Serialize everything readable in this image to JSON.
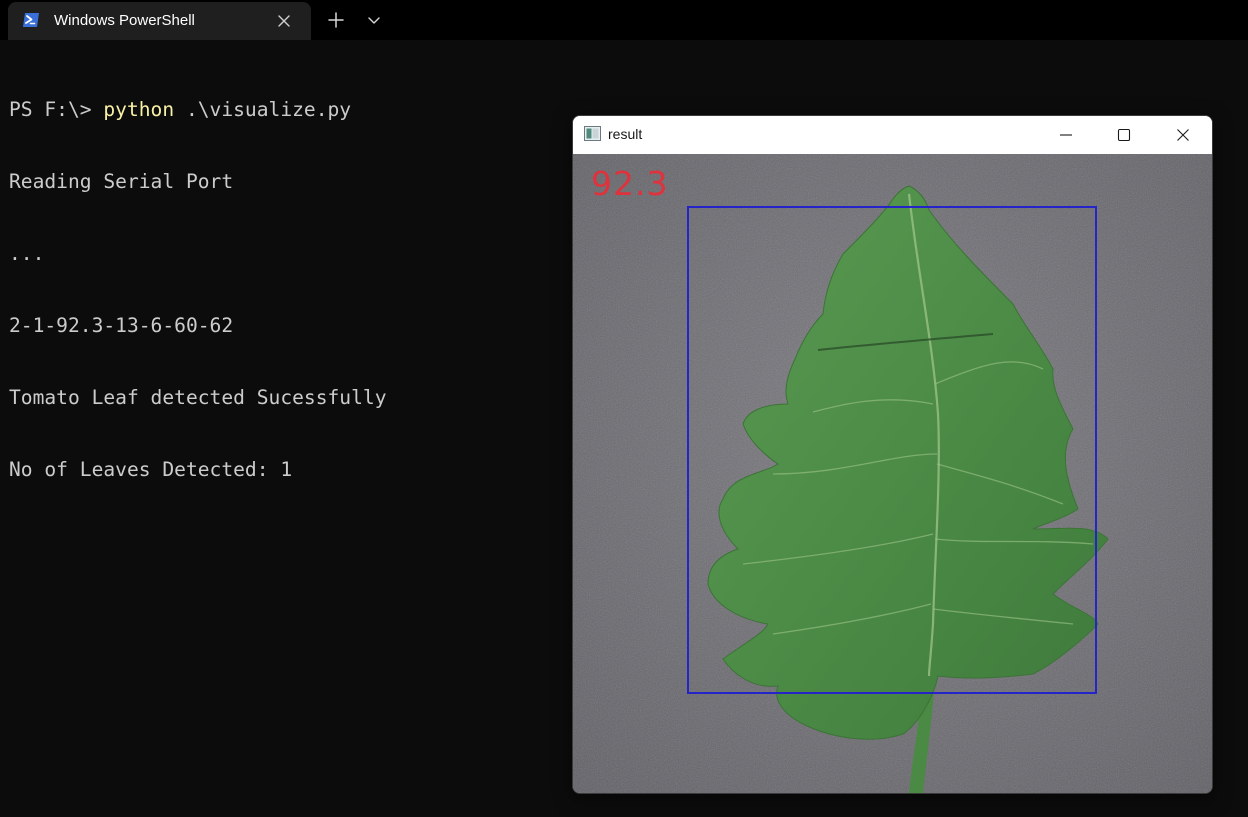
{
  "terminal_tab": {
    "title": "Windows PowerShell",
    "icon": "powershell-icon",
    "close_icon": "close-icon",
    "new_tab_icon": "plus-icon",
    "dropdown_icon": "chevron-down-icon"
  },
  "terminal": {
    "prompt": "PS F:\\> ",
    "command": "python",
    "command_args": " .\\visualize.py",
    "output_lines": [
      "Reading Serial Port",
      "...",
      "2-1-92.3-13-6-60-62",
      "Tomato Leaf detected Sucessfully",
      "No of Leaves Detected: 1"
    ],
    "colors": {
      "background": "#0c0c0c",
      "text": "#cccccc",
      "command": "#f9f1a5"
    }
  },
  "result_window": {
    "title": "result",
    "app_icon": "opencv-window-icon",
    "controls": {
      "minimize_icon": "minimize-icon",
      "maximize_icon": "maximize-icon",
      "close_icon": "close-icon"
    },
    "image": {
      "subject": "tomato-leaf",
      "score_label": "92.3",
      "score_color": "#e0323c",
      "bbox_color": "#2424c8"
    }
  }
}
